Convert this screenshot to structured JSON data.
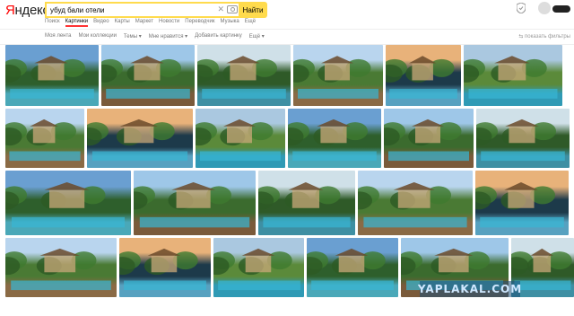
{
  "logo": {
    "brand_first": "Я",
    "brand_rest": "ндекс"
  },
  "search": {
    "query": "убуд бали отели",
    "button": "Найти"
  },
  "tabs": [
    "Поиск",
    "Картинки",
    "Видео",
    "Карты",
    "Маркет",
    "Новости",
    "Переводчик",
    "Музыка",
    "Ещё"
  ],
  "active_tab": "Картинки",
  "toolbar": {
    "items": [
      "Моя лента",
      "Мои коллекции",
      "Темы ▾",
      "Мне нравится ▾",
      "Добавить картинку",
      "Ещё ▾"
    ],
    "right": "⇆ показать фильтры"
  },
  "watermark": "YAPLAKAL.COM",
  "colors": {
    "accent": "#ffdb4d",
    "active_tab_underline": "#ff3333"
  },
  "images": [
    [
      {
        "w": 104,
        "label": "hotel-infinity-pool"
      },
      {
        "w": 104,
        "label": "jungle-villa"
      },
      {
        "w": 104,
        "label": "terrace-loungers"
      },
      {
        "w": 100,
        "label": "villa-house"
      },
      {
        "w": 84,
        "label": "resort-pool-white"
      },
      {
        "w": 110,
        "label": "infinity-pool-valley"
      }
    ],
    [
      {
        "w": 88,
        "label": "aerial-villa"
      },
      {
        "w": 118,
        "label": "treehouse-villa"
      },
      {
        "w": 100,
        "label": "sunset-pool"
      },
      {
        "w": 104,
        "label": "night-resort"
      },
      {
        "w": 100,
        "label": "evening-pool"
      },
      {
        "w": 104,
        "label": "cliff-loungers"
      }
    ],
    [
      {
        "w": 140,
        "label": "lagoon-pool"
      },
      {
        "w": 136,
        "label": "jungle-pool-steps"
      },
      {
        "w": 108,
        "label": "pavilion-pool"
      },
      {
        "w": 128,
        "label": "resort-grounds"
      },
      {
        "w": 104,
        "label": "valley-terrace"
      }
    ],
    [
      {
        "w": 124,
        "label": "infinity-edge-deck"
      },
      {
        "w": 102,
        "label": "courtyard-pool"
      },
      {
        "w": 102,
        "label": "night-resort-pool"
      },
      {
        "w": 102,
        "label": "garden-pool"
      },
      {
        "w": 120,
        "label": "jungle-loungers"
      },
      {
        "w": 70,
        "label": "palm-valley"
      }
    ]
  ]
}
